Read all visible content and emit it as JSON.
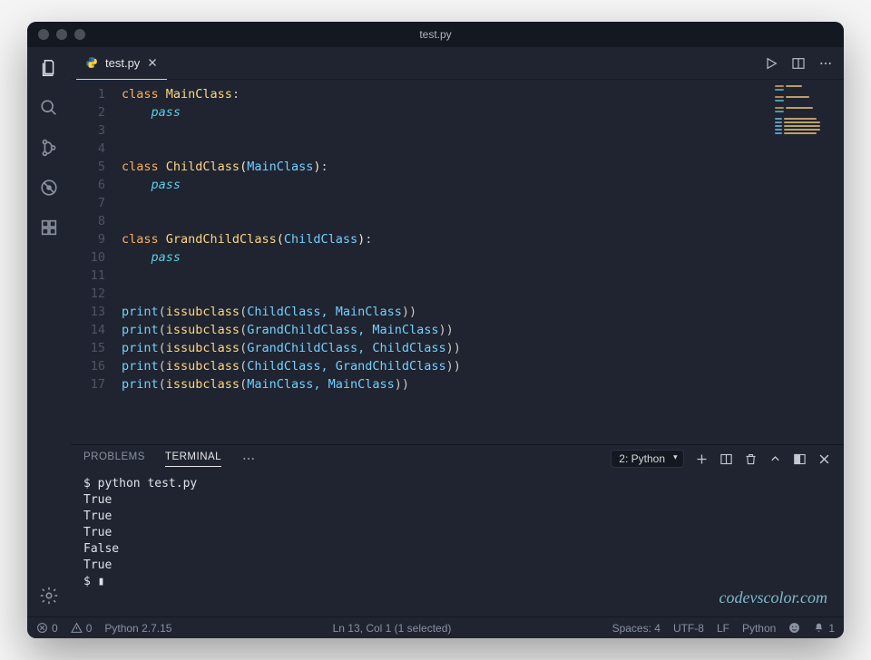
{
  "window": {
    "title": "test.py"
  },
  "tabs": {
    "active": {
      "label": "test.py"
    }
  },
  "code": {
    "lines": [
      [
        {
          "t": "class ",
          "c": "kw"
        },
        {
          "t": "MainClass",
          "c": "cls"
        },
        {
          "t": ":",
          "c": "punct"
        }
      ],
      [
        {
          "t": "    pass",
          "c": "kw-ital"
        }
      ],
      [],
      [],
      [
        {
          "t": "class ",
          "c": "kw"
        },
        {
          "t": "ChildClass",
          "c": "cls"
        },
        {
          "t": "(",
          "c": "paren"
        },
        {
          "t": "MainClass",
          "c": "arg"
        },
        {
          "t": ")",
          "c": "paren"
        },
        {
          "t": ":",
          "c": "punct"
        }
      ],
      [
        {
          "t": "    pass",
          "c": "kw-ital"
        }
      ],
      [],
      [],
      [
        {
          "t": "class ",
          "c": "kw"
        },
        {
          "t": "GrandChildClass",
          "c": "cls"
        },
        {
          "t": "(",
          "c": "paren"
        },
        {
          "t": "ChildClass",
          "c": "arg"
        },
        {
          "t": ")",
          "c": "paren"
        },
        {
          "t": ":",
          "c": "punct"
        }
      ],
      [
        {
          "t": "    pass",
          "c": "kw-ital"
        }
      ],
      [],
      [],
      [
        {
          "t": "print",
          "c": "fn"
        },
        {
          "t": "(",
          "c": "punct"
        },
        {
          "t": "issubclass",
          "c": "call"
        },
        {
          "t": "(",
          "c": "punct"
        },
        {
          "t": "ChildClass, MainClass",
          "c": "arg"
        },
        {
          "t": "))",
          "c": "punct"
        }
      ],
      [
        {
          "t": "print",
          "c": "fn"
        },
        {
          "t": "(",
          "c": "punct"
        },
        {
          "t": "issubclass",
          "c": "call"
        },
        {
          "t": "(",
          "c": "punct"
        },
        {
          "t": "GrandChildClass, MainClass",
          "c": "arg"
        },
        {
          "t": "))",
          "c": "punct"
        }
      ],
      [
        {
          "t": "print",
          "c": "fn"
        },
        {
          "t": "(",
          "c": "punct"
        },
        {
          "t": "issubclass",
          "c": "call"
        },
        {
          "t": "(",
          "c": "punct"
        },
        {
          "t": "GrandChildClass, ChildClass",
          "c": "arg"
        },
        {
          "t": "))",
          "c": "punct"
        }
      ],
      [
        {
          "t": "print",
          "c": "fn"
        },
        {
          "t": "(",
          "c": "punct"
        },
        {
          "t": "issubclass",
          "c": "call"
        },
        {
          "t": "(",
          "c": "punct"
        },
        {
          "t": "ChildClass, GrandChildClass",
          "c": "arg"
        },
        {
          "t": "))",
          "c": "punct"
        }
      ],
      [
        {
          "t": "print",
          "c": "fn"
        },
        {
          "t": "(",
          "c": "punct"
        },
        {
          "t": "issubclass",
          "c": "call"
        },
        {
          "t": "(",
          "c": "punct"
        },
        {
          "t": "MainClass, MainClass",
          "c": "arg"
        },
        {
          "t": "))",
          "c": "punct"
        }
      ]
    ]
  },
  "panel": {
    "tabs": {
      "problems": "PROBLEMS",
      "terminal": "TERMINAL"
    },
    "terminal_selector": "2: Python",
    "terminal_output": "$ python test.py\nTrue\nTrue\nTrue\nFalse\nTrue\n$ ▮",
    "watermark": "codevscolor.com"
  },
  "statusbar": {
    "errors": "0",
    "warnings": "0",
    "interpreter": "Python 2.7.15",
    "cursor": "Ln 13, Col 1 (1 selected)",
    "spaces": "Spaces: 4",
    "encoding": "UTF-8",
    "eol": "LF",
    "language": "Python",
    "notifications": "1"
  }
}
